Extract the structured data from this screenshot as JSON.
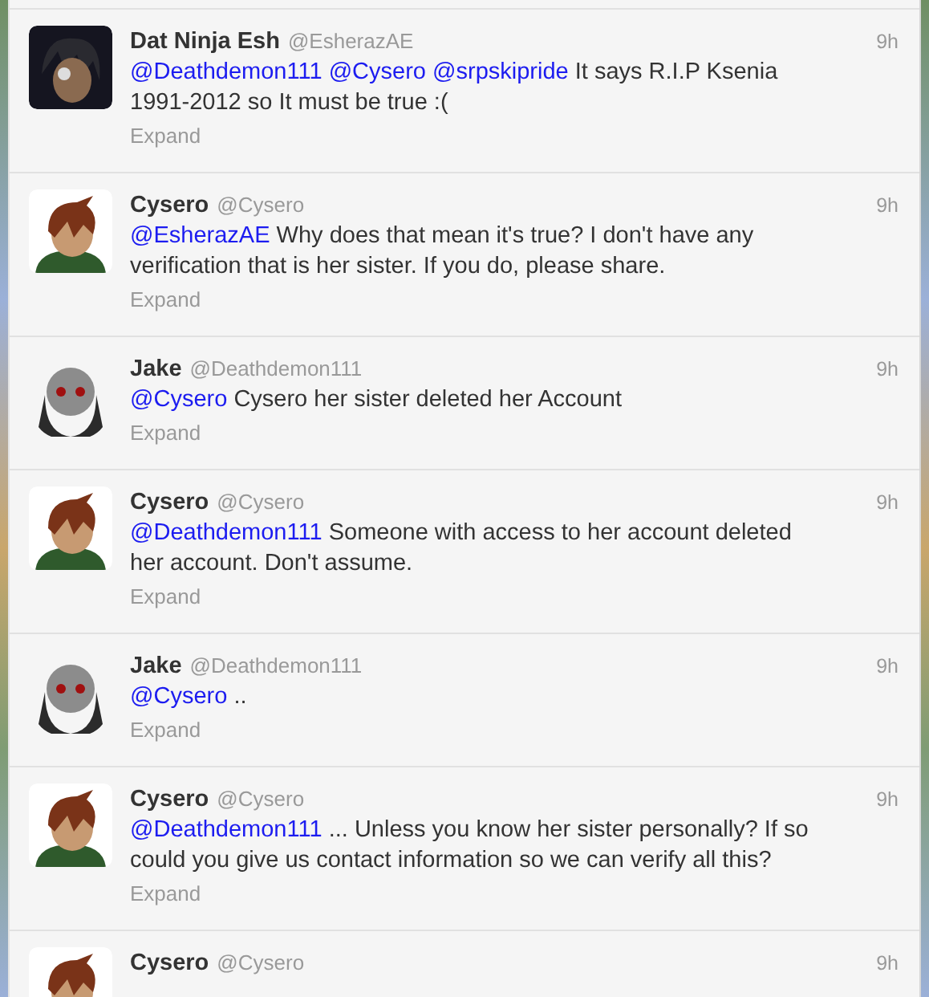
{
  "tweets": [
    {
      "kind": "dark",
      "name": "Dat Ninja Esh",
      "handle": "@EsherazAE",
      "time": "9h",
      "body": [
        {
          "kind": "mention",
          "text": "@Deathdemon111"
        },
        {
          "kind": "mention",
          "text": "@Cysero"
        },
        {
          "kind": "mention",
          "text": "@srpskipride"
        },
        {
          "kind": "text",
          "text": "It says R.I.P Ksenia 1991-2012 so It must be true :("
        }
      ],
      "expand": "Expand"
    },
    {
      "kind": "brown",
      "name": "Cysero",
      "handle": "@Cysero",
      "time": "9h",
      "body": [
        {
          "kind": "mention",
          "text": "@EsherazAE"
        },
        {
          "kind": "text",
          "text": "Why does that mean it's true? I don't have any verification that is her sister. If you do, please share."
        }
      ],
      "expand": "Expand"
    },
    {
      "kind": "mask",
      "name": "Jake",
      "handle": "@Deathdemon111",
      "time": "9h",
      "body": [
        {
          "kind": "mention",
          "text": "@Cysero"
        },
        {
          "kind": "text",
          "text": "Cysero her sister deleted her Account"
        }
      ],
      "expand": "Expand"
    },
    {
      "kind": "brown",
      "name": "Cysero",
      "handle": "@Cysero",
      "time": "9h",
      "body": [
        {
          "kind": "mention",
          "text": "@Deathdemon111"
        },
        {
          "kind": "text",
          "text": "Someone with access to her account deleted her account. Don't assume."
        }
      ],
      "expand": "Expand"
    },
    {
      "kind": "mask",
      "name": "Jake",
      "handle": "@Deathdemon111",
      "time": "9h",
      "body": [
        {
          "kind": "mention",
          "text": "@Cysero"
        },
        {
          "kind": "text",
          "text": ".."
        }
      ],
      "expand": "Expand"
    },
    {
      "kind": "brown",
      "name": "Cysero",
      "handle": "@Cysero",
      "time": "9h",
      "body": [
        {
          "kind": "mention",
          "text": "@Deathdemon111"
        },
        {
          "kind": "text",
          "text": "... Unless you know her sister personally? If so could you give us contact information so we can verify all this?"
        }
      ],
      "expand": "Expand"
    },
    {
      "kind": "brown",
      "name": "Cysero",
      "handle": "@Cysero",
      "time": "9h"
    }
  ]
}
